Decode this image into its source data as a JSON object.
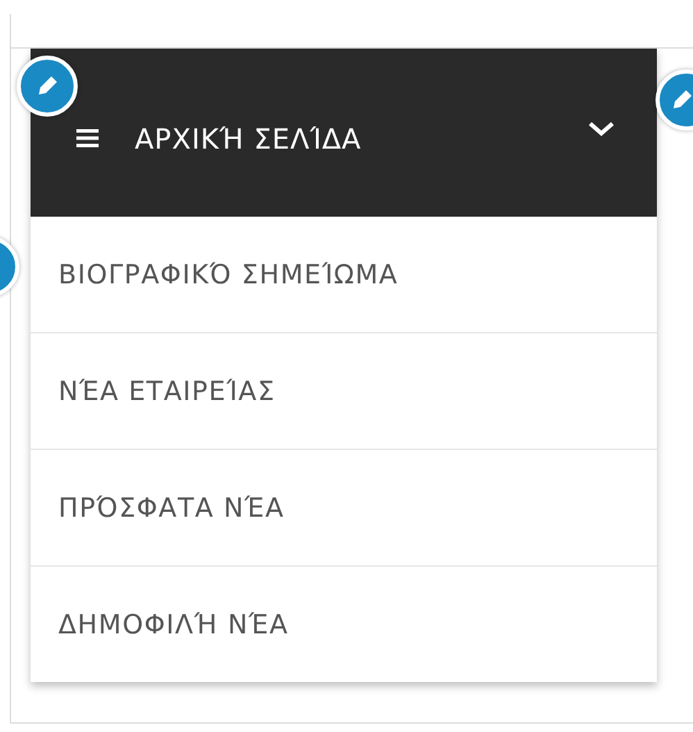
{
  "header": {
    "title": "ΑΡΧΙΚΉ ΣΕΛΊΔΑ",
    "expanded": true
  },
  "menu_items": [
    {
      "label": "ΒΙΟΓΡΑΦΙΚΌ ΣΗΜΕΊΩΜΑ"
    },
    {
      "label": "ΝΈΑ ΕΤΑΙΡΕΊΑΣ"
    },
    {
      "label": "ΠΡΌΣΦΑΤΑ ΝΈΑ"
    },
    {
      "label": "ΔΗΜΟΦΙΛΉ ΝΈΑ"
    }
  ]
}
